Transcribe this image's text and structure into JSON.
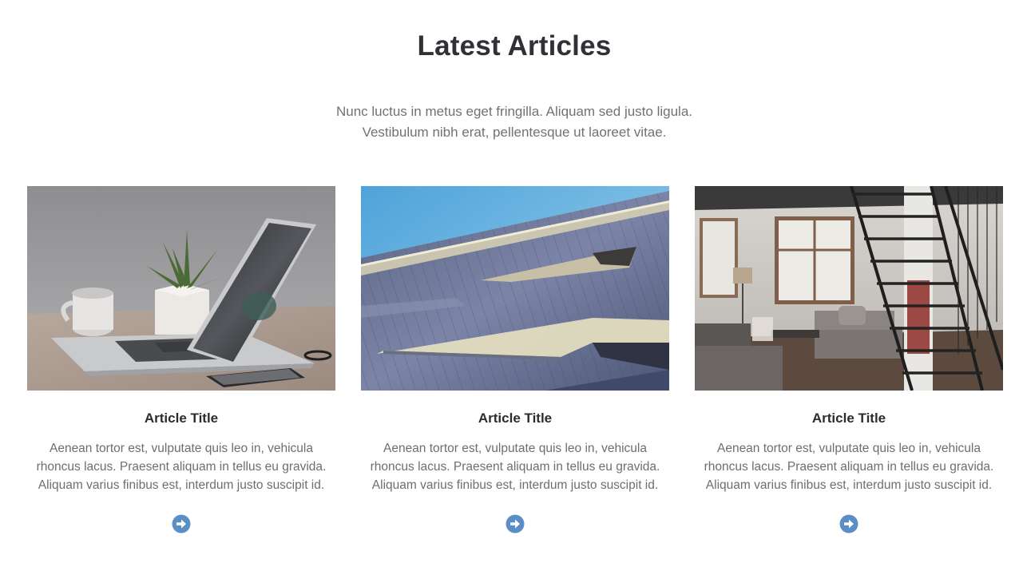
{
  "section": {
    "title": "Latest Articles",
    "intro_line1": "Nunc luctus in metus eget fringilla. Aliquam sed justo ligula.",
    "intro_line2": "Vestibulum nibh erat, pellentesque ut laoreet vitae."
  },
  "articles": [
    {
      "title": "Article Title",
      "line1": "Aenean tortor est, vulputate quis leo in, vehicula",
      "line2": "rhoncus lacus. Praesent aliquam in tellus eu gravida.",
      "line3": "Aliquam varius finibus est, interdum justo suscipit id.",
      "image": "laptop-desk-photo",
      "icon": "arrow-circle-right-icon"
    },
    {
      "title": "Article Title",
      "line1": "Aenean tortor est, vulputate quis leo in, vehicula",
      "line2": "rhoncus lacus. Praesent aliquam in tellus eu gravida.",
      "line3": "Aliquam varius finibus est, interdum justo suscipit id.",
      "image": "building-facade-photo",
      "icon": "arrow-circle-right-icon"
    },
    {
      "title": "Article Title",
      "line1": "Aenean tortor est, vulputate quis leo in, vehicula",
      "line2": "rhoncus lacus. Praesent aliquam in tellus eu gravida.",
      "line3": "Aliquam varius finibus est, interdum justo suscipit id.",
      "image": "loft-living-room-photo",
      "icon": "arrow-circle-right-icon"
    }
  ],
  "colors": {
    "accent": "#5b8ec5",
    "heading": "#2f3136",
    "body_text": "#6b6e72"
  }
}
